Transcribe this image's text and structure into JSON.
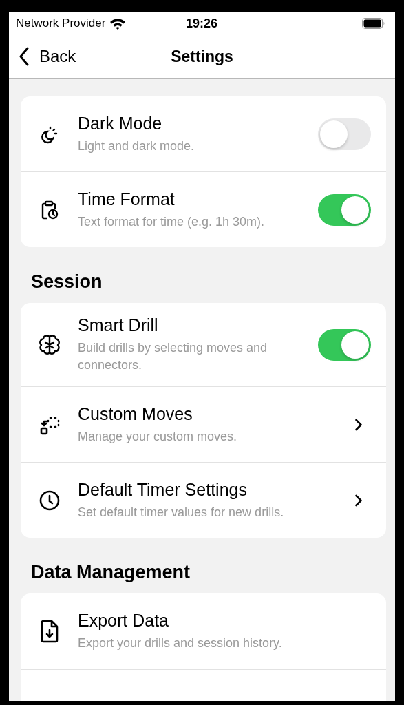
{
  "status_bar": {
    "carrier": "Network Provider",
    "time": "19:26"
  },
  "nav": {
    "back": "Back",
    "title": "Settings"
  },
  "sections": [
    {
      "rows": [
        {
          "kind": "toggle",
          "title": "Dark Mode",
          "subtitle": "Light and dark mode.",
          "on": false
        },
        {
          "kind": "toggle",
          "title": "Time Format",
          "subtitle": "Text format for time (e.g. 1h 30m).",
          "on": true
        }
      ]
    },
    {
      "title": "Session",
      "rows": [
        {
          "kind": "toggle",
          "title": "Smart Drill",
          "subtitle": "Build drills by selecting moves and connectors.",
          "on": true
        },
        {
          "kind": "link",
          "title": "Custom Moves",
          "subtitle": "Manage your custom moves."
        },
        {
          "kind": "link",
          "title": "Default Timer Settings",
          "subtitle": "Set default timer values for new drills."
        }
      ]
    },
    {
      "title": "Data Management",
      "rows": [
        {
          "kind": "link-plain",
          "title": "Export Data",
          "subtitle": "Export your drills and session history."
        },
        {
          "kind": "danger"
        }
      ]
    }
  ]
}
